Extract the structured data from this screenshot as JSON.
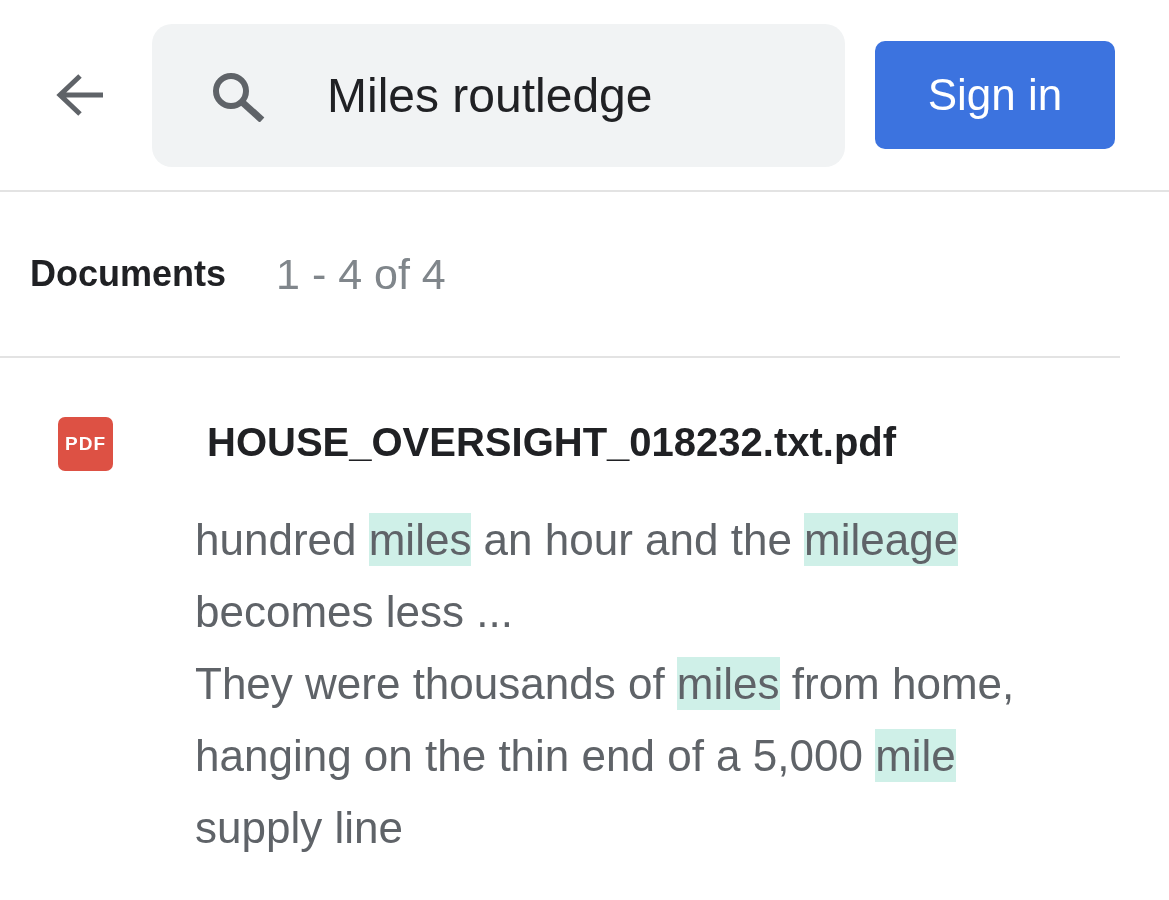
{
  "header": {
    "search": {
      "value": "Miles routledge"
    },
    "sign_in_button": {
      "label": "Sign in"
    }
  },
  "results_header": {
    "title": "Documents",
    "count": "1 - 4 of 4"
  },
  "results": [
    {
      "file_type": "PDF",
      "title": "HOUSE_OVERSIGHT_018232.txt.pdf",
      "snippets": [
        [
          {
            "text": "hundred ",
            "highlighted": false
          },
          {
            "text": "miles",
            "highlighted": true
          },
          {
            "text": " an hour and the ",
            "highlighted": false
          },
          {
            "text": "mileage",
            "highlighted": true
          },
          {
            "text": " becomes less ...",
            "highlighted": false
          }
        ],
        [
          {
            "text": "They were thousands of ",
            "highlighted": false
          },
          {
            "text": "miles",
            "highlighted": true
          },
          {
            "text": " from home, hanging on the thin end of a 5,000 ",
            "highlighted": false
          },
          {
            "text": "mile",
            "highlighted": true
          },
          {
            "text": " supply line",
            "highlighted": false
          }
        ]
      ]
    }
  ]
}
